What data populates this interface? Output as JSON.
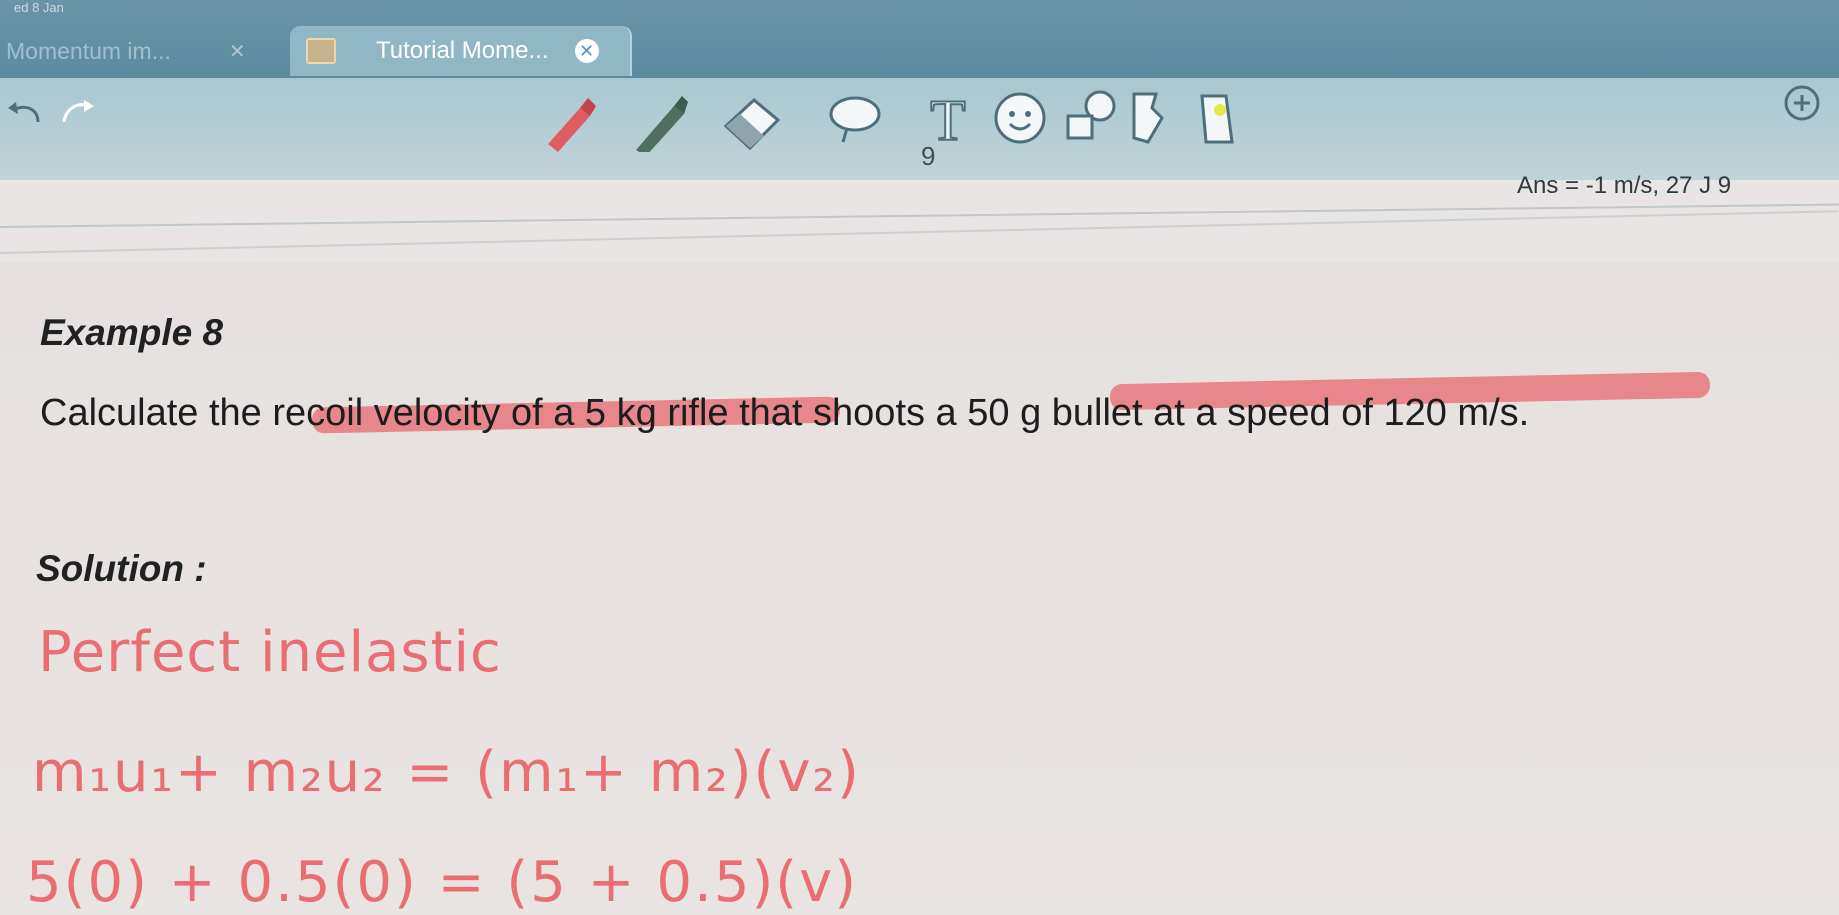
{
  "tabs": [
    {
      "title": "Momentum im...",
      "close": "✕"
    },
    {
      "title": "Tutorial Mome...",
      "close": "✕"
    }
  ],
  "date_label": "ed 8 Jan",
  "toolbar": {
    "icons": [
      "undo-icon",
      "redo-icon",
      "pen-icon",
      "pencil-icon",
      "eraser-icon",
      "lasso-icon",
      "text-tool-icon",
      "sticker-icon",
      "shapes-icon",
      "shape-draw-icon",
      "laser-pointer-icon",
      "add-page-icon"
    ],
    "text_tool_glyph": "T",
    "add_glyph": "+"
  },
  "page_number": "9",
  "answer": "Ans = -1 m/s, 27 J  9",
  "document": {
    "example_title": "Example 8",
    "question": "Calculate the recoil velocity of a 5 kg rifle that shoots a 50 g bullet at a speed of 120 m/s.",
    "solution_label": "Solution :"
  },
  "handwriting": {
    "line1": "Perfect inelastic",
    "line2": "m₁u₁+ m₂u₂ = (m₁+ m₂)(v₂)",
    "line3": "5(0) + 0.5(0) = (5 + 0.5)(v)"
  },
  "colors": {
    "tabbar": "#5b8a9e",
    "toolbar": "#b6cfd5",
    "page": "#e9e4e2",
    "handwriting": "#ea6d73",
    "highlight": "#e97076"
  }
}
